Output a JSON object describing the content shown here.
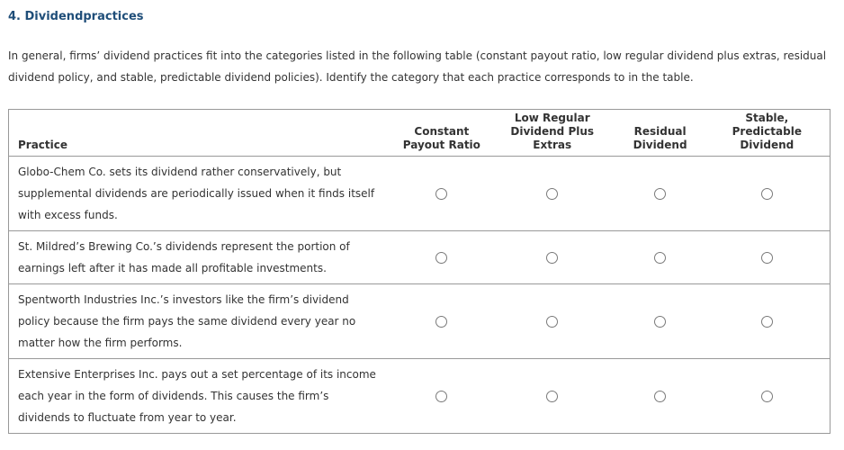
{
  "question": {
    "title": "4. Dividendpractices",
    "intro": "In general, firms’ dividend practices fit into the categories listed in the following table (constant payout ratio, low regular dividend plus extras, residual dividend policy, and stable, predictable dividend policies). Identify the category that each practice corresponds to in the table."
  },
  "table": {
    "headers": {
      "practice": "Practice",
      "options": [
        [
          "Constant",
          "Payout Ratio"
        ],
        [
          "Low Regular",
          "Dividend Plus",
          "Extras"
        ],
        [
          "Residual",
          "Dividend"
        ],
        [
          "Stable,",
          "Predictable",
          "Dividend"
        ]
      ]
    },
    "rows": [
      {
        "practice_lines": [
          "Globo-Chem Co. sets its dividend rather conservatively, but",
          "supplemental dividends are periodically issued when it finds itself",
          "with excess funds."
        ],
        "selected": null
      },
      {
        "practice_lines": [
          "St. Mildred’s Brewing Co.’s dividends represent the portion of",
          "earnings left after it has made all profitable investments."
        ],
        "selected": null
      },
      {
        "practice_lines": [
          "Spentworth Industries Inc.’s investors like the firm’s dividend",
          "policy because the firm pays the same dividend every year no",
          "matter how the firm performs."
        ],
        "selected": null
      },
      {
        "practice_lines": [
          "Extensive Enterprises Inc. pays out a set percentage of its income",
          "each year in the form of dividends. This causes the firm’s",
          "dividends to fluctuate from year to year."
        ],
        "selected": null
      }
    ]
  }
}
